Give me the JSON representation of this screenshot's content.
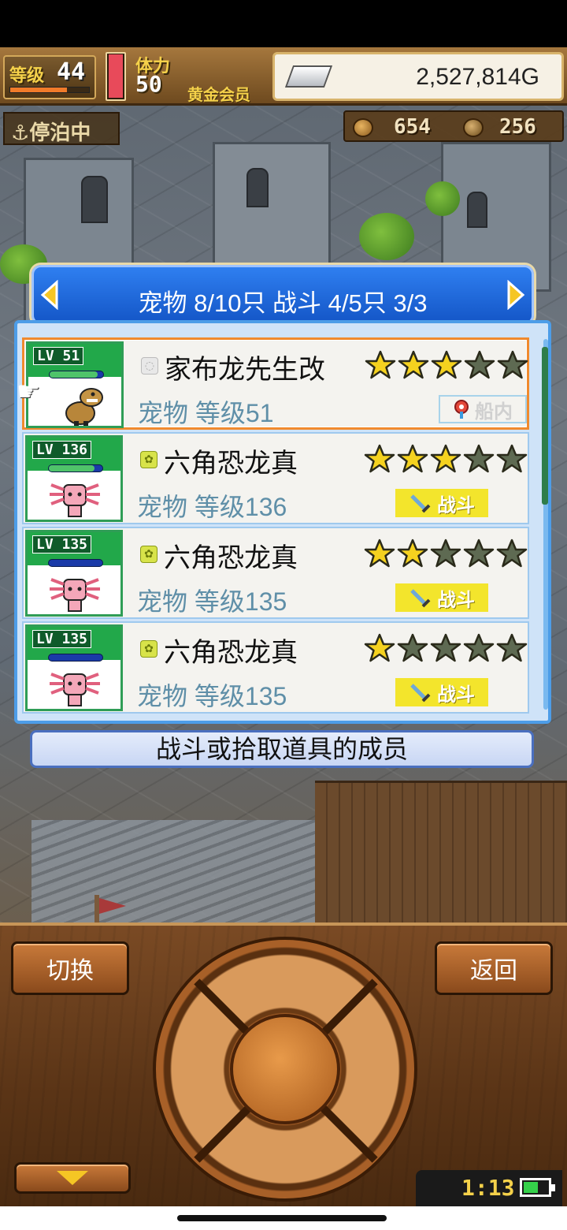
{
  "hud": {
    "level_label": "等级",
    "level": "44",
    "level_progress": 0.72,
    "stamina_label": "体力",
    "stamina": "50",
    "stamina_level": 0.95,
    "membership": "黄金会员",
    "money": "2,527,814G",
    "docked_label": "停泊中",
    "counter_a": "654",
    "counter_b": "256"
  },
  "dialog": {
    "title": "宠物 8/10只 战斗 4/5只  3/3",
    "footer": "战斗或拾取道具的成员"
  },
  "pets": [
    {
      "lv_badge": "LV 51",
      "name": "家布龙先生改",
      "sub": "宠物 等级51",
      "stars": 3,
      "status": "船内",
      "status_type": "ship",
      "element_icon": "neutral-element-icon",
      "hp": 0.9,
      "sprite": "dinosaur-sprite"
    },
    {
      "lv_badge": "LV 136",
      "name": "六角恐龙真",
      "sub": "宠物 等级136",
      "stars": 3,
      "status": "战斗",
      "status_type": "battle",
      "element_icon": "swirl-element-icon",
      "hp": 0.85,
      "sprite": "axolotl-sprite"
    },
    {
      "lv_badge": "LV 135",
      "name": "六角恐龙真",
      "sub": "宠物 等级135",
      "stars": 2,
      "status": "战斗",
      "status_type": "battle",
      "element_icon": "swirl-element-icon",
      "hp": 0.0,
      "sprite": "axolotl-sprite"
    },
    {
      "lv_badge": "LV 135",
      "name": "六角恐龙真",
      "sub": "宠物 等级135",
      "stars": 1,
      "status": "战斗",
      "status_type": "battle",
      "element_icon": "swirl-element-icon",
      "hp": 0.0,
      "sprite": "axolotl-sprite"
    }
  ],
  "controls": {
    "switch_label": "切换",
    "back_label": "返回",
    "clock": "1:13",
    "battery_level": 0.6
  },
  "colors": {
    "star_on": "#f5d21f",
    "star_off": "#5e6a52",
    "battle_tag": "#f3e52c",
    "selected_border": "#f08a2e",
    "header_blue": "#1f6fe0"
  }
}
